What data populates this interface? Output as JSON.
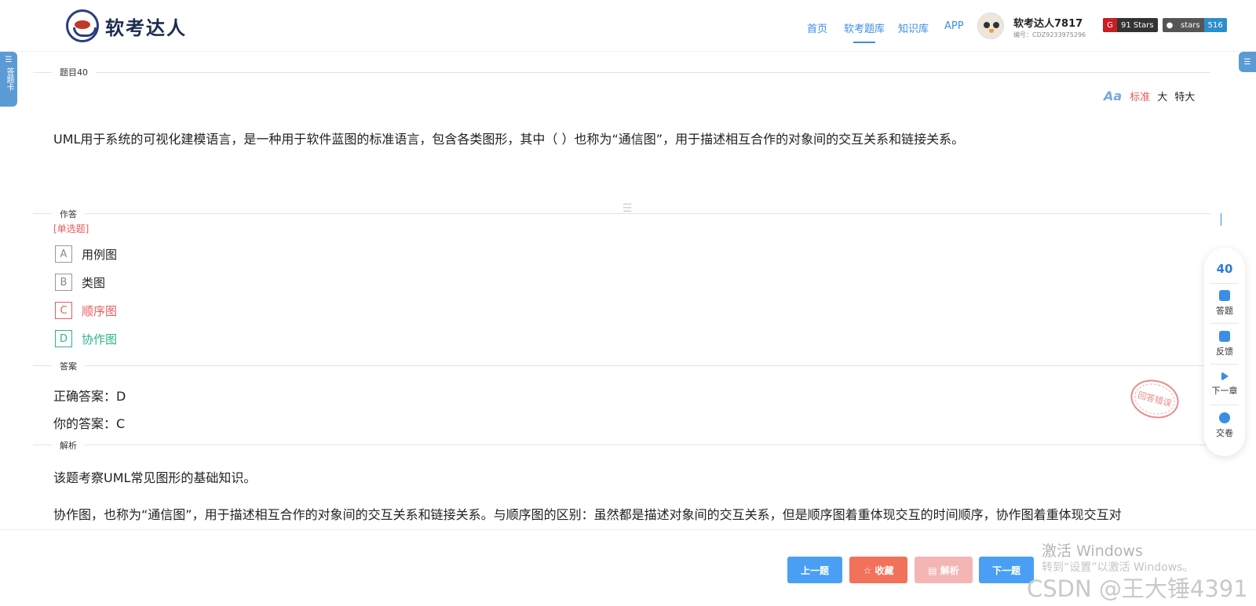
{
  "header": {
    "logo_text": "软考达人",
    "nav": [
      "首页",
      "软考题库",
      "知识库",
      "APP"
    ],
    "active_nav": "软考题库",
    "user_name": "软考达人7817",
    "user_id": "编号：CDZ9233975296",
    "badge_stars": "91 Stars",
    "badge_github_label": "stars",
    "badge_github_count": "516"
  },
  "left_tab": "答题卡",
  "question": {
    "section_label": "题目40",
    "font_sizes": [
      "标准",
      "大",
      "特大"
    ],
    "active_font_size": "标准",
    "text": "UML用于系统的可视化建模语言，是一种用于软件蓝图的标准语言，包含各类图形，其中（ ）也称为“通信图”，用于描述相互合作的对象间的交互关系和链接关系。"
  },
  "answer_area": {
    "section_label": "作答",
    "type": "[单选题]",
    "options": [
      {
        "letter": "A",
        "text": "用例图"
      },
      {
        "letter": "B",
        "text": "类图"
      },
      {
        "letter": "C",
        "text": "顺序图"
      },
      {
        "letter": "D",
        "text": "协作图"
      }
    ]
  },
  "answer": {
    "section_label": "答案",
    "correct": "正确答案：D",
    "yours": "你的答案：C",
    "stamp": "回答错误"
  },
  "analysis": {
    "section_label": "解析",
    "p1": "该题考察UML常见图形的基础知识。",
    "p2": "协作图，也称为“通信图”，用于描述相互合作的对象间的交互关系和链接关系。与顺序图的区别：虽然都是描述对象间的交互关系，但是顺序图着重体现交互的时间顺序，协作图着重体现交互对"
  },
  "right_panel": {
    "number": "40",
    "items": [
      "答题",
      "反馈",
      "下一章",
      "交卷"
    ]
  },
  "buttons": {
    "prev": "上一题",
    "fav": "☆ 收藏",
    "analysis": "▤ 解析",
    "next": "下一题"
  },
  "watermark": {
    "line1": "激活 Windows",
    "line2": "转到“设置”以激活 Windows。",
    "csdn": "CSDN @王大锤4391"
  },
  "colors": {
    "primary": "#3a8ee6",
    "wrong": "#e85d5d",
    "right": "#2bb58a"
  }
}
